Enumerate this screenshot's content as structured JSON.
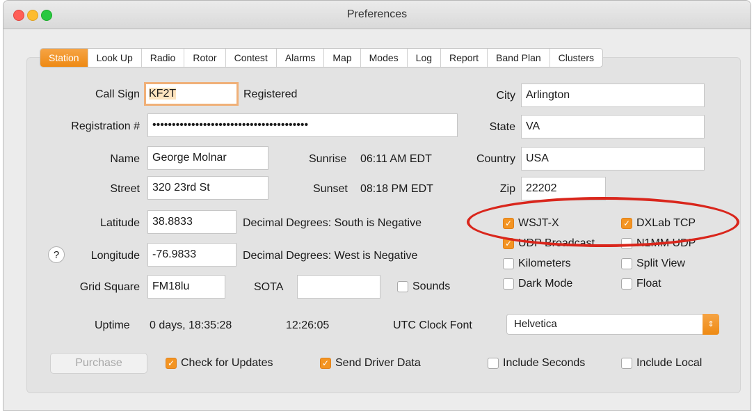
{
  "window": {
    "title": "Preferences"
  },
  "tabs": [
    "Station",
    "Look Up",
    "Radio",
    "Rotor",
    "Contest",
    "Alarms",
    "Map",
    "Modes",
    "Log",
    "Report",
    "Band Plan",
    "Clusters"
  ],
  "station": {
    "call_sign_label": "Call Sign",
    "call_sign_value": "KF2T",
    "registered_text": "Registered",
    "registration_label": "Registration #",
    "registration_value": "••••••••••••••••••••••••••••••••••••••••",
    "name_label": "Name",
    "name_value": "George Molnar",
    "street_label": "Street",
    "street_value": "320 23rd St",
    "latitude_label": "Latitude",
    "latitude_value": "38.8833",
    "latitude_hint": "Decimal Degrees: South is Negative",
    "longitude_label": "Longitude",
    "longitude_value": "-76.9833",
    "longitude_hint": "Decimal Degrees: West is Negative",
    "grid_label": "Grid Square",
    "grid_value": "FM18lu",
    "sota_label": "SOTA",
    "sota_value": "",
    "sunrise_label": "Sunrise",
    "sunrise_value": "06:11 AM EDT",
    "sunset_label": "Sunset",
    "sunset_value": "08:18 PM EDT",
    "city_label": "City",
    "city_value": "Arlington",
    "state_label": "State",
    "state_value": "VA",
    "country_label": "Country",
    "country_value": "USA",
    "zip_label": "Zip",
    "zip_value": "22202",
    "uptime_label": "Uptime",
    "uptime_value": "0 days, 18:35:28",
    "clock_value": "12:26:05",
    "utc_font_label": "UTC Clock Font",
    "utc_font_value": "Helvetica",
    "help_label": "?",
    "purchase_label": "Purchase"
  },
  "checkboxes": {
    "sounds": {
      "label": "Sounds",
      "checked": false
    },
    "wsjtx": {
      "label": "WSJT-X",
      "checked": true
    },
    "dxlab": {
      "label": "DXLab TCP",
      "checked": true
    },
    "udp": {
      "label": "UDP Broadcast",
      "checked": true
    },
    "n1mm": {
      "label": "N1MM UDP",
      "checked": false
    },
    "km": {
      "label": "Kilometers",
      "checked": false
    },
    "split": {
      "label": "Split View",
      "checked": false
    },
    "dark": {
      "label": "Dark Mode",
      "checked": false
    },
    "float": {
      "label": "Float",
      "checked": false
    },
    "updates": {
      "label": "Check for Updates",
      "checked": true
    },
    "driver": {
      "label": "Send Driver Data",
      "checked": true
    },
    "seconds": {
      "label": "Include Seconds",
      "checked": false
    },
    "local": {
      "label": "Include Local",
      "checked": false
    }
  },
  "colors": {
    "accent": "#ee8a13",
    "annotation": "#d9261c"
  }
}
